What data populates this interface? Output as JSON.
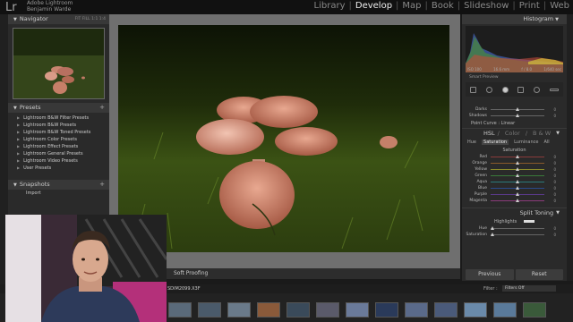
{
  "app": {
    "logo": "Lr",
    "identity_line1": "Adobe Lightroom",
    "identity_line2": "Benjamin Warde",
    "modules": [
      "Library",
      "Develop",
      "Map",
      "Book",
      "Slideshow",
      "Print",
      "Web"
    ],
    "active_module": "Develop"
  },
  "left": {
    "navigator_title": "Navigator",
    "zoom_options": "FIT  FILL  1:1  1:4",
    "presets_title": "Presets",
    "presets": [
      "Lightroom B&W Filter Presets",
      "Lightroom B&W Presets",
      "Lightroom B&W Toned Presets",
      "Lightroom Color Presets",
      "Lightroom Effect Presets",
      "Lightroom General Presets",
      "Lightroom Video Presets",
      "User Presets"
    ],
    "snapshots_title": "Snapshots",
    "snapshot_item": "Import"
  },
  "toolbar": {
    "soft_proofing": "Soft Proofing"
  },
  "right": {
    "histogram_title": "Histogram",
    "histo_iso": "ISO 100",
    "histo_focal": "16.6 mm",
    "histo_aperture": "f / 8.0",
    "histo_shutter": "1/640 sec",
    "smart_preview": "Smart Preview",
    "tone_sliders": [
      {
        "label": "Darks",
        "value": "0"
      },
      {
        "label": "Shadows",
        "value": "0"
      }
    ],
    "point_curve_label": "Point Curve :",
    "point_curve_value": "Linear",
    "hsl": {
      "active": "HSL",
      "sep1": "/",
      "color": "Color",
      "sep2": "/",
      "bw": "B & W"
    },
    "hsl_tabs": [
      "Hue",
      "Saturation",
      "Luminance",
      "All"
    ],
    "saturation_title": "Saturation",
    "saturation_sliders": [
      {
        "label": "Red",
        "value": "0"
      },
      {
        "label": "Orange",
        "value": "0"
      },
      {
        "label": "Yellow",
        "value": "0"
      },
      {
        "label": "Green",
        "value": "0"
      },
      {
        "label": "Aqua",
        "value": "0"
      },
      {
        "label": "Blue",
        "value": "0"
      },
      {
        "label": "Purple",
        "value": "0"
      },
      {
        "label": "Magenta",
        "value": "0"
      }
    ],
    "split_toning_title": "Split Toning",
    "highlights_label": "Highlights",
    "hue_label": "Hue",
    "hue_value": "0",
    "saturation_label": "Saturation",
    "saturation_value": "0",
    "previous_button": "Previous",
    "reset_button": "Reset"
  },
  "filmstrip": {
    "filename": "SDIM2099.X3F",
    "filter_label": "Filter :",
    "filter_value": "Filters Off"
  },
  "colors": {
    "accent": "#eeeeee",
    "panel": "#2a2a2a",
    "photo_bg": "#6f6f6f"
  }
}
